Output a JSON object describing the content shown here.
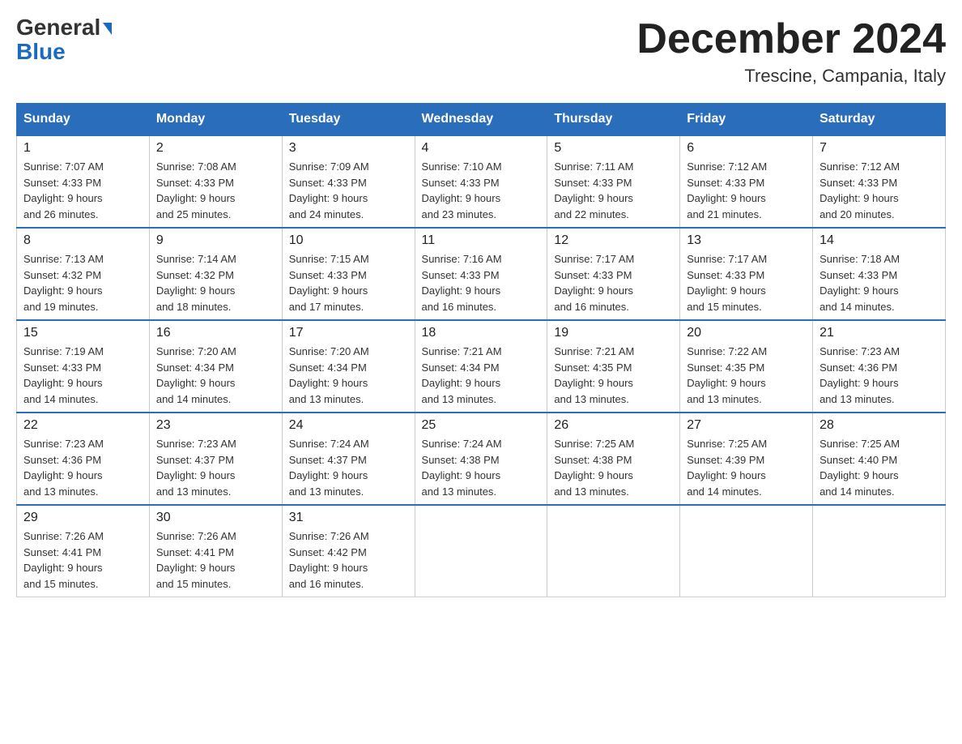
{
  "header": {
    "logo_line1": "General",
    "logo_line2": "Blue",
    "month_title": "December 2024",
    "location": "Trescine, Campania, Italy"
  },
  "weekdays": [
    "Sunday",
    "Monday",
    "Tuesday",
    "Wednesday",
    "Thursday",
    "Friday",
    "Saturday"
  ],
  "weeks": [
    [
      {
        "day": "1",
        "sunrise": "7:07 AM",
        "sunset": "4:33 PM",
        "daylight": "9 hours and 26 minutes."
      },
      {
        "day": "2",
        "sunrise": "7:08 AM",
        "sunset": "4:33 PM",
        "daylight": "9 hours and 25 minutes."
      },
      {
        "day": "3",
        "sunrise": "7:09 AM",
        "sunset": "4:33 PM",
        "daylight": "9 hours and 24 minutes."
      },
      {
        "day": "4",
        "sunrise": "7:10 AM",
        "sunset": "4:33 PM",
        "daylight": "9 hours and 23 minutes."
      },
      {
        "day": "5",
        "sunrise": "7:11 AM",
        "sunset": "4:33 PM",
        "daylight": "9 hours and 22 minutes."
      },
      {
        "day": "6",
        "sunrise": "7:12 AM",
        "sunset": "4:33 PM",
        "daylight": "9 hours and 21 minutes."
      },
      {
        "day": "7",
        "sunrise": "7:12 AM",
        "sunset": "4:33 PM",
        "daylight": "9 hours and 20 minutes."
      }
    ],
    [
      {
        "day": "8",
        "sunrise": "7:13 AM",
        "sunset": "4:32 PM",
        "daylight": "9 hours and 19 minutes."
      },
      {
        "day": "9",
        "sunrise": "7:14 AM",
        "sunset": "4:32 PM",
        "daylight": "9 hours and 18 minutes."
      },
      {
        "day": "10",
        "sunrise": "7:15 AM",
        "sunset": "4:33 PM",
        "daylight": "9 hours and 17 minutes."
      },
      {
        "day": "11",
        "sunrise": "7:16 AM",
        "sunset": "4:33 PM",
        "daylight": "9 hours and 16 minutes."
      },
      {
        "day": "12",
        "sunrise": "7:17 AM",
        "sunset": "4:33 PM",
        "daylight": "9 hours and 16 minutes."
      },
      {
        "day": "13",
        "sunrise": "7:17 AM",
        "sunset": "4:33 PM",
        "daylight": "9 hours and 15 minutes."
      },
      {
        "day": "14",
        "sunrise": "7:18 AM",
        "sunset": "4:33 PM",
        "daylight": "9 hours and 14 minutes."
      }
    ],
    [
      {
        "day": "15",
        "sunrise": "7:19 AM",
        "sunset": "4:33 PM",
        "daylight": "9 hours and 14 minutes."
      },
      {
        "day": "16",
        "sunrise": "7:20 AM",
        "sunset": "4:34 PM",
        "daylight": "9 hours and 14 minutes."
      },
      {
        "day": "17",
        "sunrise": "7:20 AM",
        "sunset": "4:34 PM",
        "daylight": "9 hours and 13 minutes."
      },
      {
        "day": "18",
        "sunrise": "7:21 AM",
        "sunset": "4:34 PM",
        "daylight": "9 hours and 13 minutes."
      },
      {
        "day": "19",
        "sunrise": "7:21 AM",
        "sunset": "4:35 PM",
        "daylight": "9 hours and 13 minutes."
      },
      {
        "day": "20",
        "sunrise": "7:22 AM",
        "sunset": "4:35 PM",
        "daylight": "9 hours and 13 minutes."
      },
      {
        "day": "21",
        "sunrise": "7:23 AM",
        "sunset": "4:36 PM",
        "daylight": "9 hours and 13 minutes."
      }
    ],
    [
      {
        "day": "22",
        "sunrise": "7:23 AM",
        "sunset": "4:36 PM",
        "daylight": "9 hours and 13 minutes."
      },
      {
        "day": "23",
        "sunrise": "7:23 AM",
        "sunset": "4:37 PM",
        "daylight": "9 hours and 13 minutes."
      },
      {
        "day": "24",
        "sunrise": "7:24 AM",
        "sunset": "4:37 PM",
        "daylight": "9 hours and 13 minutes."
      },
      {
        "day": "25",
        "sunrise": "7:24 AM",
        "sunset": "4:38 PM",
        "daylight": "9 hours and 13 minutes."
      },
      {
        "day": "26",
        "sunrise": "7:25 AM",
        "sunset": "4:38 PM",
        "daylight": "9 hours and 13 minutes."
      },
      {
        "day": "27",
        "sunrise": "7:25 AM",
        "sunset": "4:39 PM",
        "daylight": "9 hours and 14 minutes."
      },
      {
        "day": "28",
        "sunrise": "7:25 AM",
        "sunset": "4:40 PM",
        "daylight": "9 hours and 14 minutes."
      }
    ],
    [
      {
        "day": "29",
        "sunrise": "7:26 AM",
        "sunset": "4:41 PM",
        "daylight": "9 hours and 15 minutes."
      },
      {
        "day": "30",
        "sunrise": "7:26 AM",
        "sunset": "4:41 PM",
        "daylight": "9 hours and 15 minutes."
      },
      {
        "day": "31",
        "sunrise": "7:26 AM",
        "sunset": "4:42 PM",
        "daylight": "9 hours and 16 minutes."
      },
      null,
      null,
      null,
      null
    ]
  ],
  "labels": {
    "sunrise": "Sunrise:",
    "sunset": "Sunset:",
    "daylight": "Daylight:"
  }
}
